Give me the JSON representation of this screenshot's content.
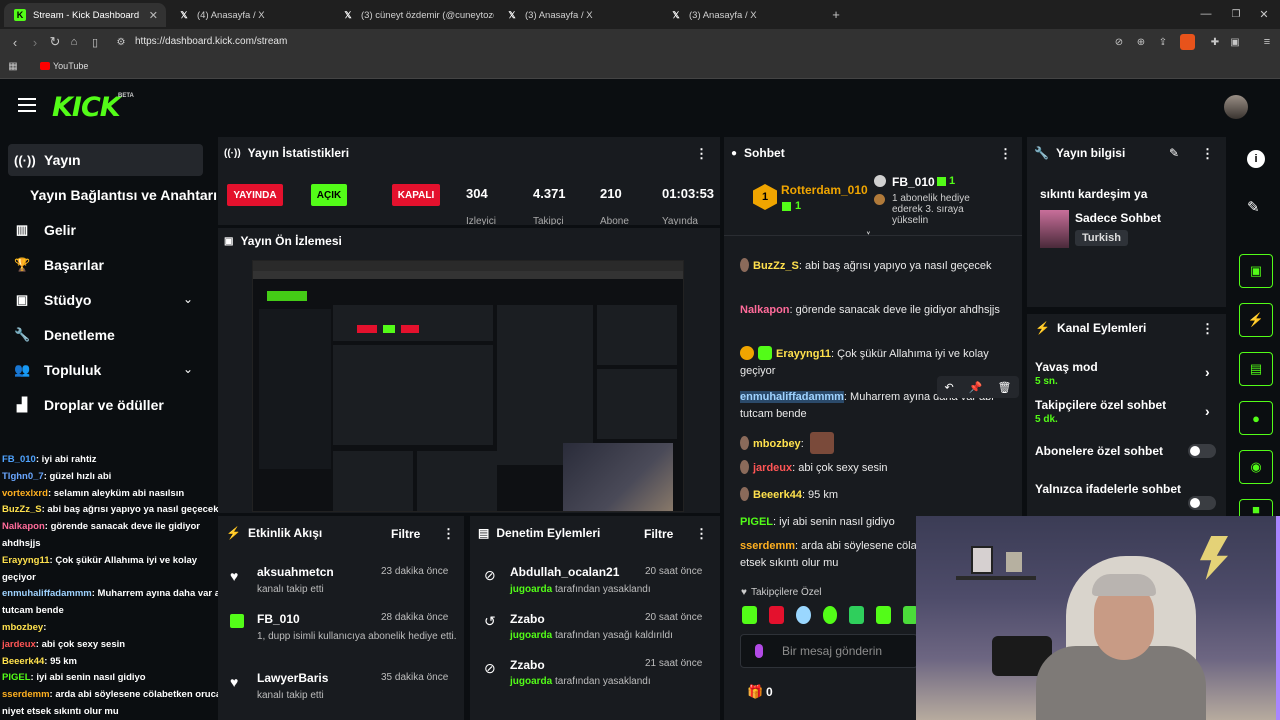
{
  "browser": {
    "tabs": [
      {
        "title": "Stream - Kick Dashboard",
        "icon": "kick-icon"
      },
      {
        "title": "(4) Anasayfa / X",
        "icon": "x-icon"
      },
      {
        "title": "(3) cüneyt özdemir (@cuneytozdem",
        "icon": "x-icon"
      },
      {
        "title": "(3) Anasayfa / X",
        "icon": "x-icon"
      },
      {
        "title": "(3) Anasayfa / X",
        "icon": "x-icon"
      }
    ],
    "url": "https://dashboard.kick.com/stream",
    "bookmark": "YouTube"
  },
  "header": {
    "logo": "KICK",
    "beta": "BETA"
  },
  "sidebar": {
    "items": [
      {
        "label": "Yayın",
        "icon": "broadcast-icon"
      },
      {
        "label": "Yayın Bağlantısı ve Anahtarı",
        "icon": ""
      },
      {
        "label": "Gelir",
        "icon": "chart-icon"
      },
      {
        "label": "Başarılar",
        "icon": "trophy-icon"
      },
      {
        "label": "Stüdyo",
        "icon": "studio-icon"
      },
      {
        "label": "Denetleme",
        "icon": "wrench-icon"
      },
      {
        "label": "Topluluk",
        "icon": "people-icon"
      },
      {
        "label": "Droplar ve ödüller",
        "icon": "drops-icon"
      }
    ]
  },
  "overlay_chat": [
    {
      "user": "FB_010",
      "text": ": iyi abi rahtiz",
      "color": "#4fa3ff"
    },
    {
      "user": "Tlghn0_7",
      "text": ": güzel hızlı abi",
      "color": "#6aa7ff"
    },
    {
      "user": "vortexlxrd",
      "text": ": selamın aleyküm abi nasılsın",
      "color": "#ffb020"
    },
    {
      "user": "BuzZz_S",
      "text": ": abi baş ağrısı yapıyo ya nasıl geçecek",
      "color": "#ffe14d"
    },
    {
      "user": "Nalkapon",
      "text": ": görende sanacak deve ile gidiyor",
      "color": "#ff6b9a"
    },
    {
      "user": "",
      "text": "ahdhsjjs",
      "color": "#ffffff"
    },
    {
      "user": "Erayyng11",
      "text": ": Çok şükür Allahıma iyi ve kolay",
      "color": "#ffe14d"
    },
    {
      "user": "",
      "text": "geçiyor",
      "color": "#ffffff"
    },
    {
      "user": "enmuhaliffadammm",
      "text": ": Muharrem ayına daha var abi",
      "color": "#9fd3ff"
    },
    {
      "user": "",
      "text": "tutcam bende",
      "color": "#ffffff"
    },
    {
      "user": "mbozbey",
      "text": ":",
      "color": "#ffe14d"
    },
    {
      "user": "jardeux",
      "text": ": abi çok sexy sesin",
      "color": "#ff5555"
    },
    {
      "user": "Beeerk44",
      "text": ": 95 km",
      "color": "#ffe14d"
    },
    {
      "user": "PIGEL",
      "text": ": iyi abi senin nasıl gidiyo",
      "color": "#53fc18"
    },
    {
      "user": "sserdemm",
      "text": ": arda abi söylesene cölabetken oruca",
      "color": "#ffb020"
    },
    {
      "user": "",
      "text": "niyet etsek sıkıntı olur mu",
      "color": "#ffffff"
    }
  ],
  "stats": {
    "title": "Yayın İstatistikleri",
    "live_badge": "YAYINDA",
    "open_badge": "AÇIK",
    "closed_badge": "KAPALI",
    "values": [
      "304",
      "4.371",
      "210",
      "01:03:53"
    ],
    "labels": [
      "İzleyici",
      "Takipçi",
      "Abone",
      "Yayında"
    ]
  },
  "preview": {
    "title": "Yayın Ön İzlemesi"
  },
  "activity": {
    "title": "Etkinlik Akışı",
    "filter": "Filtre",
    "items": [
      {
        "name": "aksuahmetcn",
        "sub": "kanalı takip etti",
        "time": "23 dakika önce",
        "icon": "heart-icon"
      },
      {
        "name": "FB_010",
        "sub": "1, dupp isimli kullanıcıya abonelik hediye etti.",
        "time": "28 dakika önce",
        "icon": "gift-icon"
      },
      {
        "name": "LawyerBaris",
        "sub": "kanalı takip etti",
        "time": "35 dakika önce",
        "icon": "heart-icon"
      }
    ]
  },
  "moderation": {
    "title": "Denetim Eylemleri",
    "filter": "Filtre",
    "items": [
      {
        "name": "Abdullah_ocalan21",
        "mod": "jugoarda",
        "sub": "tarafından yasaklandı",
        "time": "20 saat önce",
        "icon": "ban-icon"
      },
      {
        "name": "Zzabo",
        "mod": "jugoarda",
        "sub": "tarafından yasağı kaldırıldı",
        "time": "20 saat önce",
        "icon": "unban-icon"
      },
      {
        "name": "Zzabo",
        "mod": "jugoarda",
        "sub": "tarafından yasaklandı",
        "time": "21 saat önce",
        "icon": "ban-icon"
      }
    ]
  },
  "chat": {
    "title": "Sohbet",
    "pinned_gifter": {
      "rank": "1",
      "name": "Rotterdam_010",
      "count": "1"
    },
    "pinned_sub": {
      "name": "FB_010",
      "count": "1",
      "text": "1 abonelik hediye ederek 3. sıraya yükselin"
    },
    "messages": [
      {
        "user": "BuzZz_S",
        "text": ": abi baş ağrısı yapıyo ya nasıl geçecek",
        "color": "#ffe14d"
      },
      {
        "user": "Nalkapon",
        "text": ": görende sanacak deve ile gidiyor ahdhsjjs",
        "color": "#ff6b9a"
      },
      {
        "user": "Erayyng11",
        "text": ": Çok şükür Allahıma iyi ve kolay geçiyor",
        "color": "#ffe14d"
      },
      {
        "user": "enmuhaliffadammm",
        "text": ": Muharrem ayına daha var abi tutcam bende",
        "color": "#9fd3ff"
      },
      {
        "user": "mbozbey",
        "text": ":",
        "color": "#ffe14d"
      },
      {
        "user": "jardeux",
        "text": ": abi çok sexy sesin",
        "color": "#ff5555"
      },
      {
        "user": "Beeerk44",
        "text": ": 95 km",
        "color": "#ffe14d"
      },
      {
        "user": "PIGEL",
        "text": ": iyi abi senin nasıl gidiyo",
        "color": "#53fc18"
      },
      {
        "user": "sserdemm",
        "text": ": arda abi söylesene cölabetken oruca niyet etsek sıkıntı olur mu",
        "color": "#ffb020"
      }
    ],
    "followers_only": "Takipçilere Özel",
    "input_placeholder": "Bir mesaj gönderin",
    "gift_count": "0"
  },
  "stream_info": {
    "title": "Yayın bilgisi",
    "stream_title": "sıkıntı kardeşim ya",
    "category": "Sadece Sohbet",
    "language": "Turkish"
  },
  "channel_actions": {
    "title": "Kanal Eylemleri",
    "items": [
      {
        "label": "Yavaş mod",
        "value": "5 sn."
      },
      {
        "label": "Takipçilere özel sohbet",
        "value": "5 dk."
      },
      {
        "label": "Abonelere özel sohbet",
        "value": ""
      },
      {
        "label": "Yalnızca ifadelerle sohbet",
        "value": ""
      }
    ]
  },
  "colors": {
    "accent": "#53fc18",
    "live": "#e4112d",
    "panel": "#181b1f",
    "bg": "#0b0e11"
  }
}
